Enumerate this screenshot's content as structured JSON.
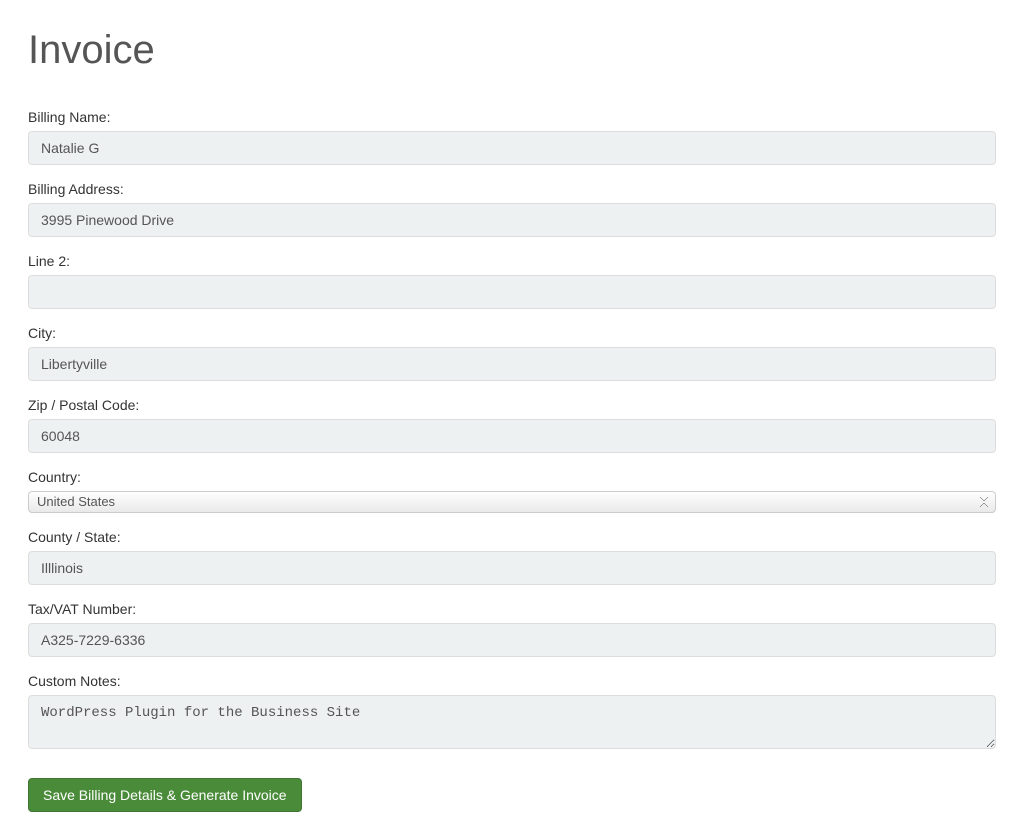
{
  "page": {
    "title": "Invoice"
  },
  "form": {
    "billing_name": {
      "label": "Billing Name:",
      "value": "Natalie G"
    },
    "billing_address": {
      "label": "Billing Address:",
      "value": "3995 Pinewood Drive"
    },
    "line2": {
      "label": "Line 2:",
      "value": ""
    },
    "city": {
      "label": "City:",
      "value": "Libertyville"
    },
    "zip": {
      "label": "Zip / Postal Code:",
      "value": "60048"
    },
    "country": {
      "label": "Country:",
      "selected": "United States"
    },
    "county_state": {
      "label": "County / State:",
      "value": "Illlinois"
    },
    "tax_vat": {
      "label": "Tax/VAT Number:",
      "value": "A325-7229-6336"
    },
    "custom_notes": {
      "label": "Custom Notes:",
      "value": "WordPress Plugin for the Business Site"
    }
  },
  "actions": {
    "submit_label": "Save Billing Details & Generate Invoice"
  }
}
